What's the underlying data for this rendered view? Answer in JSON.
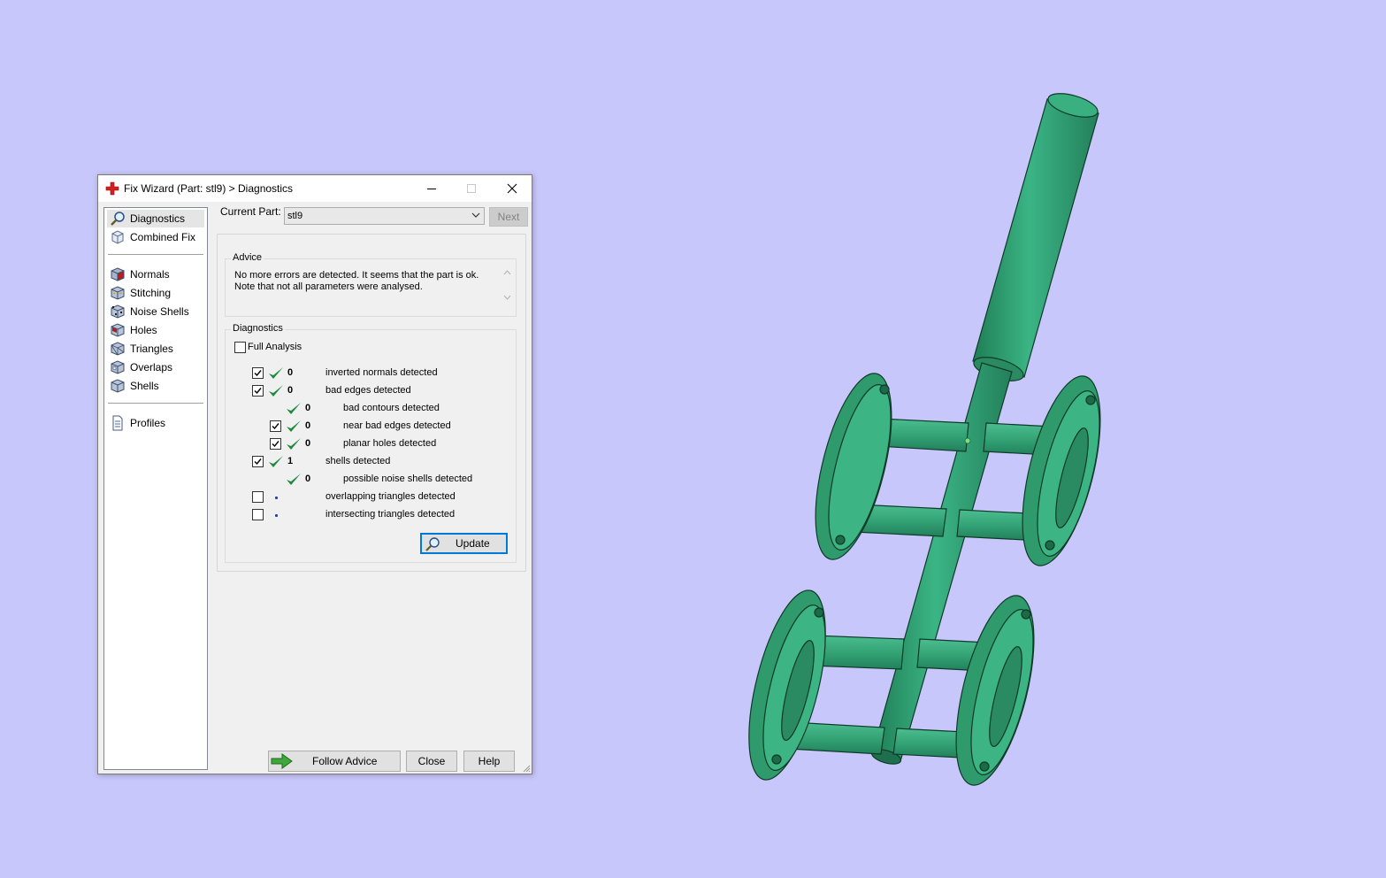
{
  "window": {
    "title": "Fix Wizard (Part: stl9) > Diagnostics"
  },
  "nav": {
    "items_top": [
      {
        "label": "Diagnostics",
        "icon": "magnifier-icon"
      },
      {
        "label": "Combined Fix",
        "icon": "combined-fix-icon"
      }
    ],
    "items_fix": [
      {
        "label": "Normals",
        "icon": "normals-cube-icon"
      },
      {
        "label": "Stitching",
        "icon": "stitching-cube-icon"
      },
      {
        "label": "Noise Shells",
        "icon": "noise-shells-icon"
      },
      {
        "label": "Holes",
        "icon": "holes-cube-icon"
      },
      {
        "label": "Triangles",
        "icon": "triangles-cube-icon"
      },
      {
        "label": "Overlaps",
        "icon": "overlaps-cube-icon"
      },
      {
        "label": "Shells",
        "icon": "shells-cube-icon"
      }
    ],
    "items_bottom": [
      {
        "label": "Profiles",
        "icon": "document-icon"
      }
    ],
    "selected": "Diagnostics"
  },
  "current_part": {
    "label": "Current Part:",
    "value": "stl9"
  },
  "next_label": "Next",
  "advice": {
    "title": "Advice",
    "text_line1": "No more errors are detected. It seems that the part is ok.",
    "text_line2": "Note that not all parameters were analysed."
  },
  "diagnostics": {
    "title": "Diagnostics",
    "full_analysis_label": "Full Analysis",
    "full_analysis_checked": false,
    "rows": [
      {
        "checkbox": true,
        "checked": true,
        "status": "ok",
        "count": "0",
        "label": "inverted normals detected",
        "indent": 0
      },
      {
        "checkbox": true,
        "checked": true,
        "status": "ok",
        "count": "0",
        "label": "bad edges detected",
        "indent": 0
      },
      {
        "checkbox": false,
        "checked": false,
        "status": "ok",
        "count": "0",
        "label": "bad contours detected",
        "indent": 1
      },
      {
        "checkbox": true,
        "checked": true,
        "status": "ok",
        "count": "0",
        "label": "near bad edges detected",
        "indent": 1
      },
      {
        "checkbox": true,
        "checked": true,
        "status": "ok",
        "count": "0",
        "label": "planar holes detected",
        "indent": 1
      },
      {
        "checkbox": true,
        "checked": true,
        "status": "ok",
        "count": "1",
        "label": "shells detected",
        "indent": 0
      },
      {
        "checkbox": false,
        "checked": false,
        "status": "ok",
        "count": "0",
        "label": "possible noise shells detected",
        "indent": 1
      },
      {
        "checkbox": true,
        "checked": false,
        "status": "pending",
        "count": "",
        "label": "overlapping triangles detected",
        "indent": 0
      },
      {
        "checkbox": true,
        "checked": false,
        "status": "pending",
        "count": "",
        "label": "intersecting triangles detected",
        "indent": 0
      }
    ],
    "update_label": "Update"
  },
  "buttons": {
    "follow_advice": "Follow Advice",
    "close": "Close",
    "help": "Help"
  },
  "colors": {
    "background": "#c8c7fb",
    "model": "#2e9a6c",
    "check_green": "#1e8a3a",
    "pending_dot": "#1a3fcc",
    "focus_blue": "#0078d7"
  }
}
